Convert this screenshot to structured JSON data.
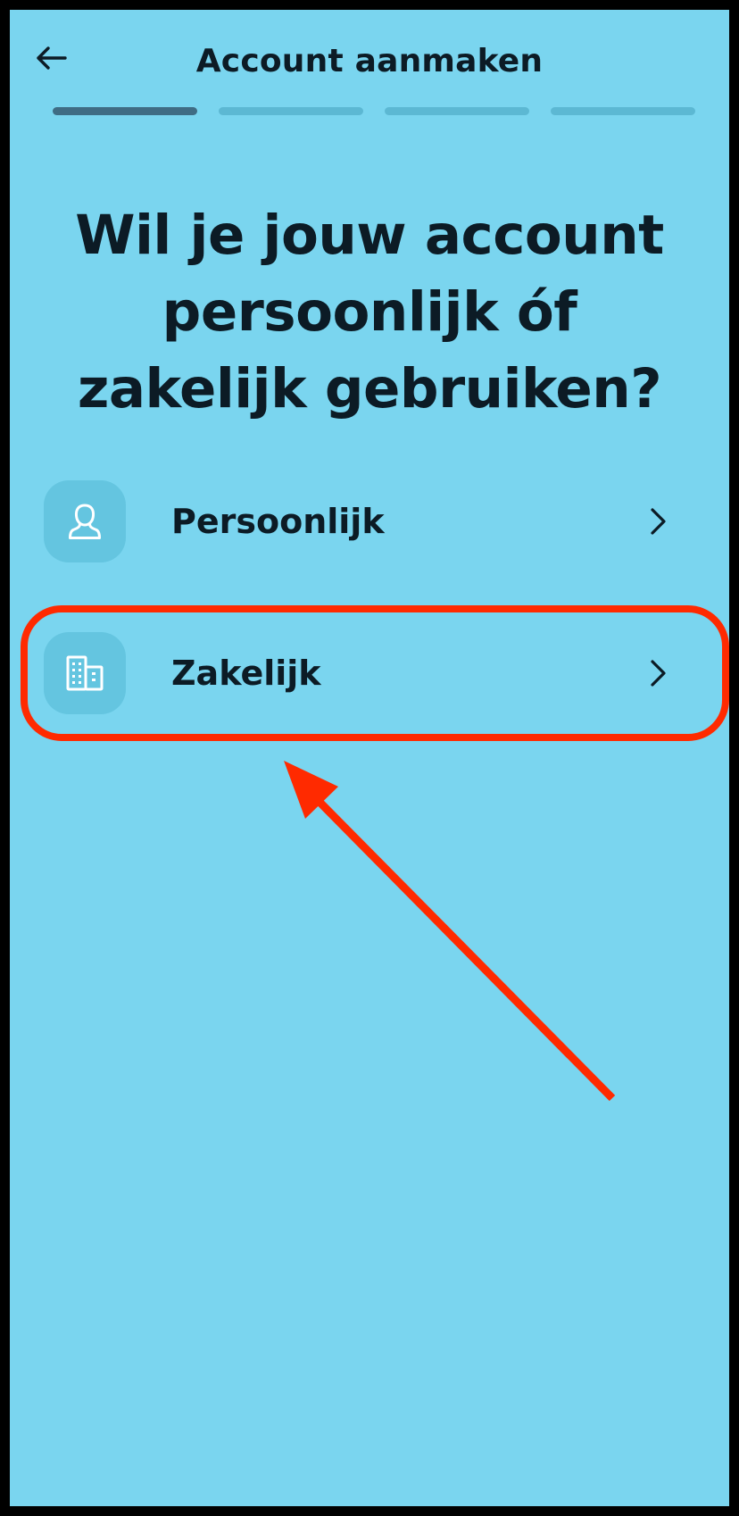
{
  "header": {
    "title": "Account aanmaken",
    "back_icon": "arrow-left-icon"
  },
  "progress": {
    "total_steps": 4,
    "current_step": 1
  },
  "question": "Wil je jouw account persoonlijk óf zakelijk gebruiken?",
  "options": [
    {
      "label": "Persoonlijk",
      "icon": "person-icon",
      "chevron": "chevron-right-icon"
    },
    {
      "label": "Zakelijk",
      "icon": "building-icon",
      "chevron": "chevron-right-icon"
    }
  ],
  "colors": {
    "background": "#7ad5ef",
    "text": "#0c1b25",
    "icon_tile": "#64c5e0",
    "progress_active": "#3f6c84",
    "progress_inactive": "#5cb8d3",
    "annotation": "#ff2a00"
  }
}
